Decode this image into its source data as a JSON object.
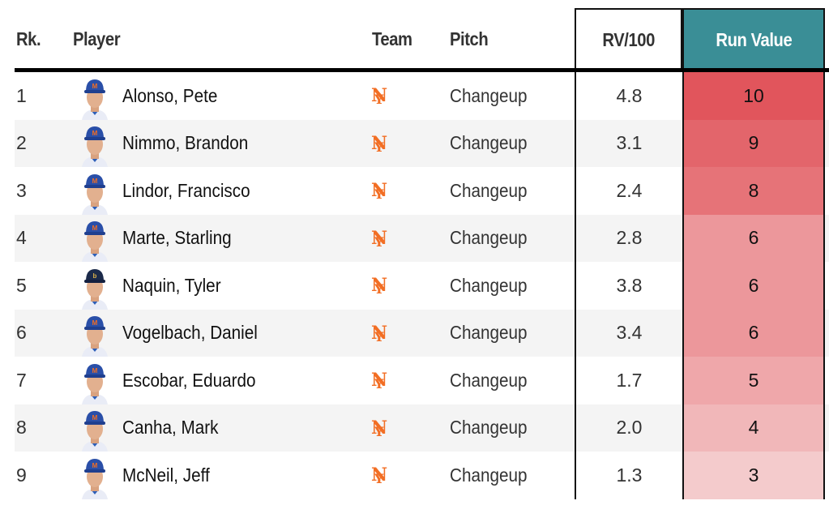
{
  "header": {
    "rank": "Rk.",
    "player": "Player",
    "team": "Team",
    "pitch": "Pitch",
    "rv100": "RV/100",
    "run_value": "Run Value"
  },
  "colors": {
    "header_accent": "#3a8e96",
    "team_logo": "#f26e24",
    "alt_row": "#f4f4f4"
  },
  "rows": [
    {
      "rank": "1",
      "name": "Alonso, Pete",
      "team": "NYM",
      "cap": "mets",
      "pitch": "Changeup",
      "rv100": "4.8",
      "run_value": "10",
      "heat": "#e1555c"
    },
    {
      "rank": "2",
      "name": "Nimmo, Brandon",
      "team": "NYM",
      "cap": "mets",
      "pitch": "Changeup",
      "rv100": "3.1",
      "run_value": "9",
      "heat": "#e3656b"
    },
    {
      "rank": "3",
      "name": "Lindor, Francisco",
      "team": "NYM",
      "cap": "mets",
      "pitch": "Changeup",
      "rv100": "2.4",
      "run_value": "8",
      "heat": "#e67378"
    },
    {
      "rank": "4",
      "name": "Marte, Starling",
      "team": "NYM",
      "cap": "mets",
      "pitch": "Changeup",
      "rv100": "2.8",
      "run_value": "6",
      "heat": "#ec979b"
    },
    {
      "rank": "5",
      "name": "Naquin, Tyler",
      "team": "NYM",
      "cap": "brewers",
      "pitch": "Changeup",
      "rv100": "3.8",
      "run_value": "6",
      "heat": "#ec979b"
    },
    {
      "rank": "6",
      "name": "Vogelbach, Daniel",
      "team": "NYM",
      "cap": "mets",
      "pitch": "Changeup",
      "rv100": "3.4",
      "run_value": "6",
      "heat": "#ec979b"
    },
    {
      "rank": "7",
      "name": "Escobar, Eduardo",
      "team": "NYM",
      "cap": "mets",
      "pitch": "Changeup",
      "rv100": "1.7",
      "run_value": "5",
      "heat": "#efa7aa"
    },
    {
      "rank": "8",
      "name": "Canha, Mark",
      "team": "NYM",
      "cap": "mets",
      "pitch": "Changeup",
      "rv100": "2.0",
      "run_value": "4",
      "heat": "#f1b7b9"
    },
    {
      "rank": "9",
      "name": "McNeil, Jeff",
      "team": "NYM",
      "cap": "mets",
      "pitch": "Changeup",
      "rv100": "1.3",
      "run_value": "3",
      "heat": "#f4cbcc"
    }
  ]
}
